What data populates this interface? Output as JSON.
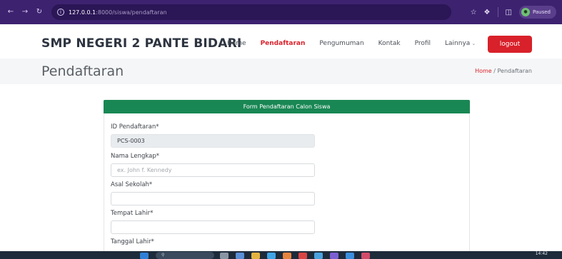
{
  "browser": {
    "url_host": "127.0.0.1",
    "url_path": ":8000/siswa/pendaftaran",
    "profile_label": "Paused"
  },
  "site": {
    "brand": "SMP NEGERI 2 PANTE BIDARI",
    "nav": {
      "home": "Home",
      "pendaftaran": "Pendaftaran",
      "pengumuman": "Pengumuman",
      "kontak": "Kontak",
      "profil": "Profil",
      "lainnya": "Lainnya"
    },
    "logout_label": "logout"
  },
  "page": {
    "title": "Pendaftaran",
    "breadcrumb_home": "Home",
    "breadcrumb_sep": "/",
    "breadcrumb_current": "Pendaftaran"
  },
  "form": {
    "header": "Form Pendaftaran Calon Siswa",
    "id_label": "ID Pendaftaran*",
    "id_value": "PCS-0003",
    "nama_label": "Nama Lengkap*",
    "nama_placeholder": "ex. John f. Kennedy",
    "asal_label": "Asal Sekolah*",
    "tempat_label": "Tempat Lahir*",
    "tanggal_label": "Tanggal Lahir*"
  },
  "taskbar": {
    "clock": "14:42"
  },
  "colors": {
    "browser_bar": "#3d2270",
    "accent_red": "#d8212a",
    "form_header_green": "#198754"
  }
}
